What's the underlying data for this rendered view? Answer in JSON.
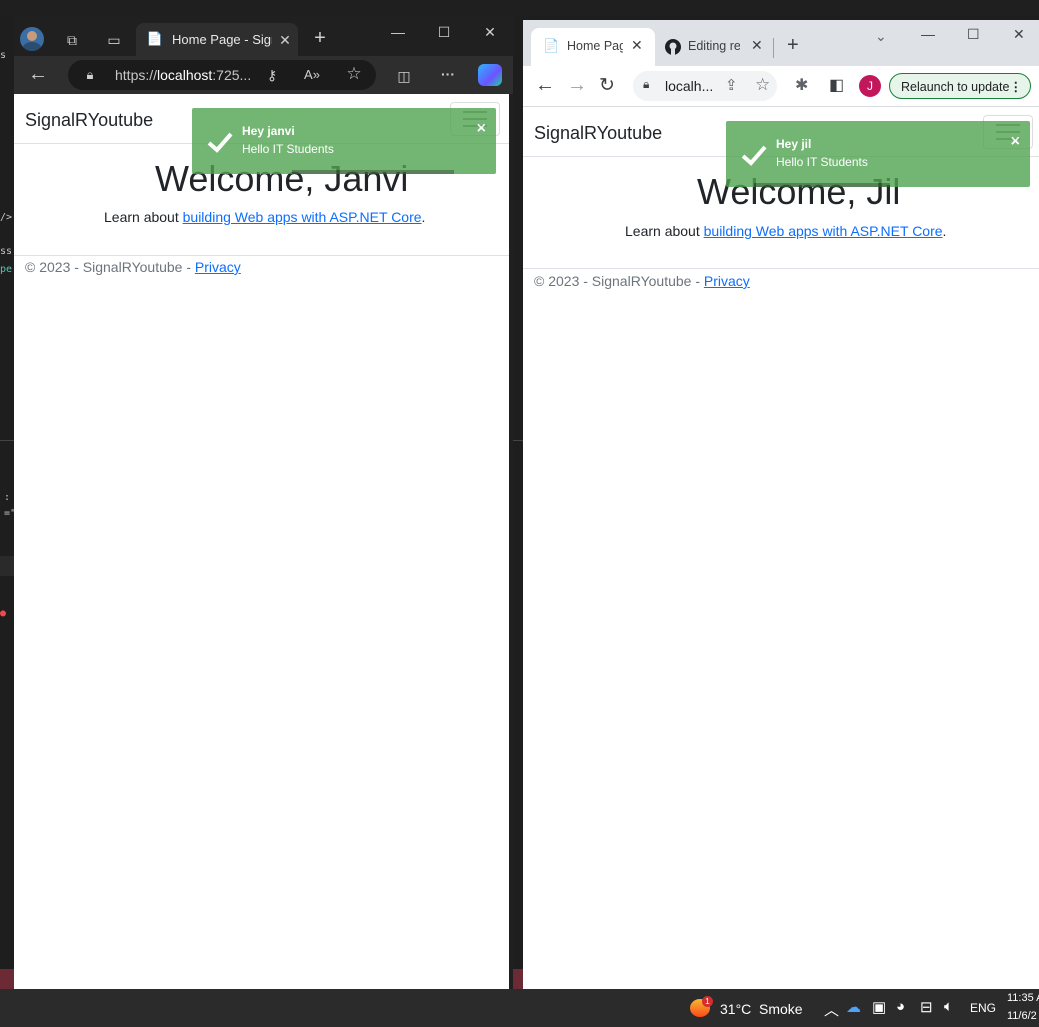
{
  "edge": {
    "tab_title": "Home Page - SignalRYoutube",
    "url_prefix": "https://",
    "url_host": "localhost",
    "url_rest": ":725...",
    "icons": [
      "profile-avatar-icon",
      "workspaces-icon",
      "tab-actions-icon",
      "page-icon",
      "close-tab-icon",
      "new-tab-icon",
      "minimize-icon",
      "maximize-icon",
      "close-window-icon",
      "back-icon",
      "lock-icon",
      "key-icon",
      "read-aloud-icon",
      "favorite-icon",
      "split-screen-icon",
      "more-icon",
      "copilot-icon"
    ]
  },
  "chrome": {
    "tabs": [
      {
        "label": "Home Page - SignalRYoutube"
      },
      {
        "label": "Editing readme"
      }
    ],
    "url": "localh...",
    "relaunch_label": "Relaunch to update",
    "profile_initial": "J"
  },
  "pages": {
    "brand": "SignalRYoutube",
    "learn_prefix": "Learn about ",
    "learn_link": "building Web apps with ASP.NET Core",
    "learn_suffix": ".",
    "footer_text": "© 2023 - SignalRYoutube - ",
    "footer_link": "Privacy",
    "edge_welcome": "Welcome, Janvi",
    "chrome_welcome": "Welcome, Jil"
  },
  "toasts": {
    "edge": {
      "title": "Hey janvi",
      "message": "Hello IT Students",
      "close": "×"
    },
    "chrome": {
      "title": "Hey jil",
      "message": "Hello IT Students",
      "close": "×"
    }
  },
  "taskbar": {
    "temperature": "31°C",
    "weather": "Smoke",
    "weather_badge": "1",
    "language": "ENG",
    "time": "11:35 A",
    "date": "11/6/2"
  },
  "colors": {
    "toast": "#51a351",
    "link": "#0d6efd",
    "relaunch_border": "#188038"
  }
}
